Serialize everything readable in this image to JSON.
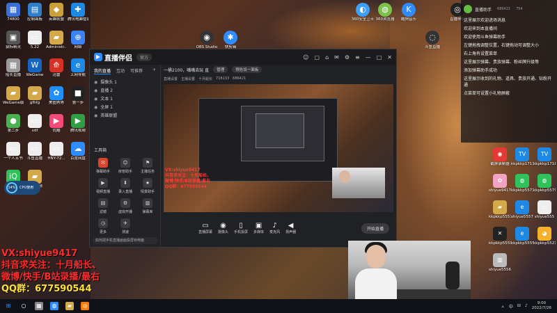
{
  "desktop": {
    "left_icons": [
      {
        "label": "74800",
        "glyph": "▦",
        "color": "#3a6fd8"
      },
      {
        "label": "控制面板",
        "glyph": "▤",
        "color": "#2f7ec7"
      },
      {
        "label": "英雄联盟",
        "glyph": "◆",
        "color": "#c9a13a"
      },
      {
        "label": "腾讯电脑管家",
        "glyph": "✚",
        "color": "#1e88e5"
      },
      {
        "label": "鼠标精灵",
        "glyph": "▣",
        "color": "#555"
      },
      {
        "label": "5.22",
        "glyph": "▭",
        "color": "#eee"
      },
      {
        "label": "Administr...",
        "glyph": "▰",
        "color": "#d4a94a"
      },
      {
        "label": "网络",
        "glyph": "⊕",
        "color": "#3b82f6"
      },
      {
        "label": "船长直播",
        "glyph": "▦",
        "color": "#999"
      },
      {
        "label": "WeGame",
        "glyph": "W",
        "color": "#1565c0"
      },
      {
        "label": "迅雷",
        "glyph": "⟰",
        "color": "#d93025"
      },
      {
        "label": "上网导航",
        "glyph": "e",
        "color": "#1e88e5"
      },
      {
        "label": "WeGame版",
        "glyph": "▰",
        "color": "#d4a94a"
      },
      {
        "label": "gfhfg",
        "glyph": "▰",
        "color": "#d4a94a"
      },
      {
        "label": "美图秀秀",
        "glyph": "✿",
        "color": "#1e90ff"
      },
      {
        "label": "第一步",
        "glyph": "■",
        "color": "#222"
      },
      {
        "label": "第二步",
        "glyph": "●",
        "color": "#4caf50"
      },
      {
        "label": "xdf",
        "glyph": "▭",
        "color": "#eee"
      },
      {
        "label": "优酷",
        "glyph": "▶",
        "color": "#f44a7a"
      },
      {
        "label": "腾讯视频",
        "glyph": "▶",
        "color": "#2f9e44"
      },
      {
        "label": "一个人五书",
        "glyph": "▭",
        "color": "#eee"
      },
      {
        "label": "斗鱼直播",
        "glyph": "▭",
        "color": "#eee"
      },
      {
        "label": "HNY-72...",
        "glyph": "▭",
        "color": "#eee"
      },
      {
        "label": "百度网盘",
        "glyph": "☁",
        "color": "#2f8cff"
      },
      {
        "label": "爱奇艺",
        "glyph": "iQ",
        "color": "#2fc25b"
      },
      {
        "label": "教学视频",
        "glyph": "▰",
        "color": "#d4a94a"
      }
    ],
    "top_icons": [
      {
        "label": "360安全卫士",
        "glyph": "◐",
        "color": "#3ba0ff"
      },
      {
        "label": "360浏览器",
        "glyph": "◍",
        "color": "#7cc24a"
      },
      {
        "label": "酷狗音乐",
        "glyph": "K",
        "color": "#2f8cff"
      },
      {
        "label": "OBS Studio",
        "glyph": "◉",
        "color": "#333"
      },
      {
        "label": "快剪辑",
        "glyph": "✱",
        "color": "#2f8cff"
      },
      {
        "label": "直播伴侣",
        "glyph": "◎",
        "color": "#222"
      },
      {
        "label": "斗鱼直播",
        "glyph": "◌",
        "color": "#333"
      }
    ],
    "right_icons": [
      {
        "label": "截屏录制器",
        "glyph": "◉",
        "color": "#e53935"
      },
      {
        "label": "kkpkkp1717",
        "glyph": "TV",
        "color": "#1e88e5"
      },
      {
        "label": "kkpkkp1718",
        "glyph": "TV",
        "color": "#1e88e5"
      },
      {
        "label": "shiyue9417",
        "glyph": "✿",
        "color": "#f2a2c2"
      },
      {
        "label": "kkpkkp5577",
        "glyph": "◍",
        "color": "#2fc25b"
      },
      {
        "label": "kkpkkp5579",
        "glyph": "◍",
        "color": "#2fc25b"
      },
      {
        "label": "kkpkkp5557",
        "glyph": "▰",
        "color": "#d4a94a"
      },
      {
        "label": "shiyue5557",
        "glyph": "e",
        "color": "#1e88e5"
      },
      {
        "label": "shiyue555",
        "glyph": "▭",
        "color": "#eee"
      },
      {
        "label": "kkpkkp5559",
        "glyph": "✕",
        "color": "#222"
      },
      {
        "label": "kkpkkp5555",
        "glyph": "e",
        "color": "#1e88e5"
      },
      {
        "label": "kkpkkp5521",
        "glyph": "◕",
        "color": "#f5b12a"
      },
      {
        "label": "shiyue5556",
        "glyph": "▥",
        "color": "#bbb"
      }
    ],
    "cpu": {
      "percent": "14%",
      "label": "CPU使用"
    }
  },
  "side_promo": [
    "VX:shiyue9417",
    "抖音求关注：十月船长、",
    "微博/快手/B站录播/最右",
    "QQ群：677590544"
  ],
  "app": {
    "title": "直播伴侣",
    "version": "官方",
    "window_buttons": [
      "☺",
      "▢",
      "⌂",
      "✉",
      "⚙",
      "≡",
      "—",
      "□",
      "✕"
    ],
    "tabs": [
      "我的直播",
      "互动",
      "可推荐"
    ],
    "scenes": [
      {
        "eye": "◉",
        "name": "摄像头 1"
      },
      {
        "eye": "◉",
        "name": "直播 2"
      },
      {
        "eye": "◉",
        "name": "文本 1"
      },
      {
        "eye": "◉",
        "name": "全屏 1"
      },
      {
        "eye": "◉",
        "name": "英雄联盟"
      }
    ],
    "tools_title": "工具箱",
    "tools": [
      {
        "glyph": "✉",
        "label": "弹幕助手",
        "hot": true
      },
      {
        "glyph": "☺",
        "label": "房管助手",
        "hot": false
      },
      {
        "glyph": "⚑",
        "label": "主播任务",
        "hot": false
      },
      {
        "glyph": "▶",
        "label": "视频直播",
        "hot": false
      },
      {
        "glyph": "⬇",
        "label": "录入直播",
        "hot": false
      },
      {
        "glyph": "★",
        "label": "情景助手",
        "hot": false
      },
      {
        "glyph": "▤",
        "label": "滤镜",
        "hot": false
      },
      {
        "glyph": "⚙",
        "label": "虚拟开播",
        "hot": false
      },
      {
        "glyph": "▥",
        "label": "弹幕库",
        "hot": false
      },
      {
        "glyph": "◷",
        "label": "更多",
        "hot": false
      },
      {
        "glyph": "✈",
        "label": "测速",
        "hot": false
      }
    ],
    "bottom_tip": "如何把手机直播画面投屏到电脑",
    "info": {
      "room": "一桶2100，嘴嘴去玩 直",
      "btn1": "管理",
      "btn2": "预告设一面板"
    },
    "subinfo": [
      "直播设置",
      "主播设置",
      "十月船长",
      "718133",
      "686421"
    ],
    "preview_promo": [
      "VX:shiyue9417",
      "抖音求关注：十月船长、",
      "微博/快手/B站录播/最右",
      "QQ群：677590544"
    ],
    "controls": [
      {
        "glyph": "▭",
        "label": "直播屏幕"
      },
      {
        "glyph": "◉",
        "label": "摄像头"
      },
      {
        "glyph": "▯",
        "label": "手机投屏"
      },
      {
        "glyph": "▣",
        "label": "多媒体"
      },
      {
        "glyph": "♪",
        "label": "麦克风"
      },
      {
        "glyph": "◀",
        "label": "扬声器"
      }
    ],
    "start_button": "开始直播",
    "status": [
      "直播时长",
      "上行速度",
      "丢帧"
    ]
  },
  "chat": {
    "title": "直播助手",
    "stats": [
      "686421",
      "754"
    ],
    "messages": [
      "这里展示欢迎进场消息",
      "欢迎来到本直播间",
      "欢迎使用斗鱼弹幕助手",
      "左键拖拽调整位置，右键拖动可调整大小",
      "右上角有设置菜单",
      "这里展示弹幕、贵族弹幕、粉丝牌升级等",
      "添加弹幕助手成功",
      "这里展示收到的礼物、道具、贵族开通、钻粉开通",
      "点菜单可设置小礼物屏蔽"
    ]
  },
  "taskbar": {
    "apps": [
      {
        "glyph": "⊞",
        "color": "#2f8cff"
      },
      {
        "glyph": "○",
        "color": "#fff"
      },
      {
        "glyph": "▦",
        "color": "#888"
      },
      {
        "glyph": "◍",
        "color": "#2f8cff"
      },
      {
        "glyph": "▰",
        "color": "#d4a94a"
      },
      {
        "glyph": "◎",
        "color": "#ff7a00"
      }
    ],
    "tray": [
      "ㅅ",
      "中",
      "⊟",
      "♪"
    ],
    "time": "9:00",
    "date": "2022/7/26"
  }
}
